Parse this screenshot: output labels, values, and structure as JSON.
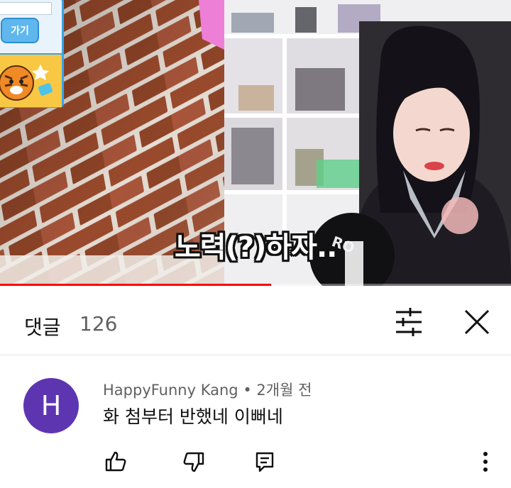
{
  "video": {
    "game_button_label": "가기",
    "subtitle": "노력(?)하자..",
    "progress": 0.53
  },
  "comments": {
    "title": "댓글",
    "count": "126"
  },
  "comment": {
    "avatar_initial": "H",
    "author": "HappyFunny Kang",
    "separator": "•",
    "time": "2개월 전",
    "text": "화 첨부터 반했네 이뻐네"
  },
  "colors": {
    "accent": "#ff0000",
    "avatar": "#5e35b1",
    "text_primary": "#0f0f0f",
    "text_secondary": "#606060"
  },
  "icons": [
    "filter-icon",
    "close-icon",
    "thumbs-up-icon",
    "thumbs-down-icon",
    "reply-icon",
    "more-vertical-icon"
  ]
}
